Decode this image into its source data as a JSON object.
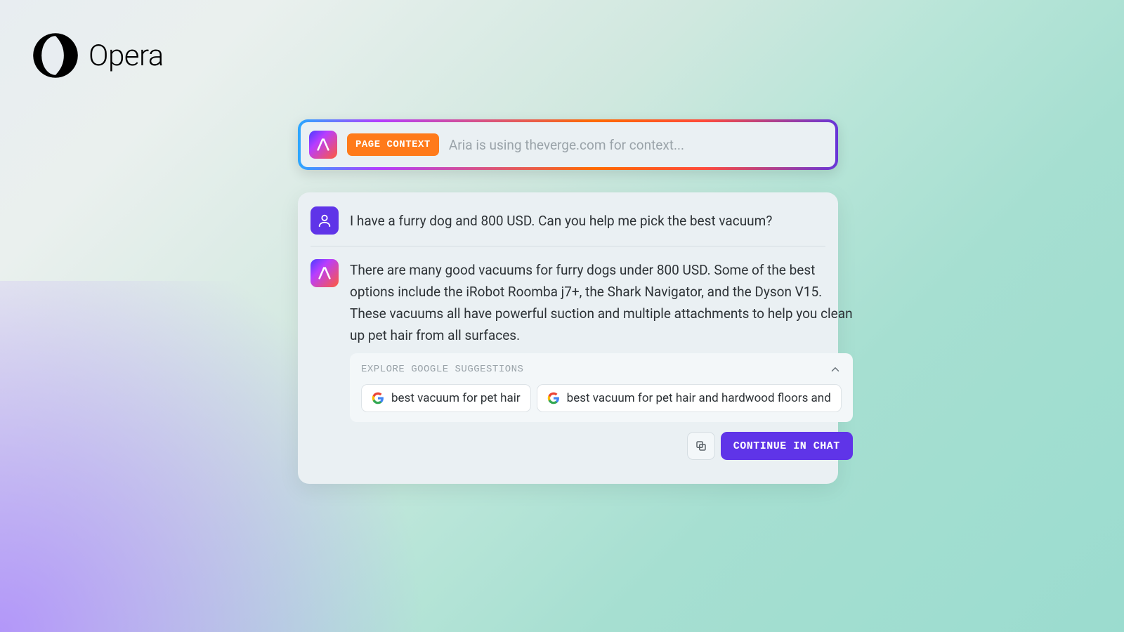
{
  "brand": {
    "name": "Opera"
  },
  "context_bar": {
    "badge_label": "PAGE CONTEXT",
    "status_text": "Aria is using theverge.com for context..."
  },
  "chat": {
    "user_message": "I have a furry dog and 800 USD. Can you help me pick the best vacuum?",
    "assistant_message": "There are many good vacuums for furry dogs under 800 USD. Some of the best options include the iRobot Roomba j7+, the Shark Navigator, and the Dyson V15. These vacuums all have powerful suction and multiple attachments to help you clean up pet hair from all surfaces."
  },
  "suggestions": {
    "title": "EXPLORE GOOGLE SUGGESTIONS",
    "items": [
      "best vacuum for pet hair",
      "best vacuum for pet hair and hardwood floors and"
    ]
  },
  "actions": {
    "continue_label": "CONTINUE IN CHAT"
  }
}
